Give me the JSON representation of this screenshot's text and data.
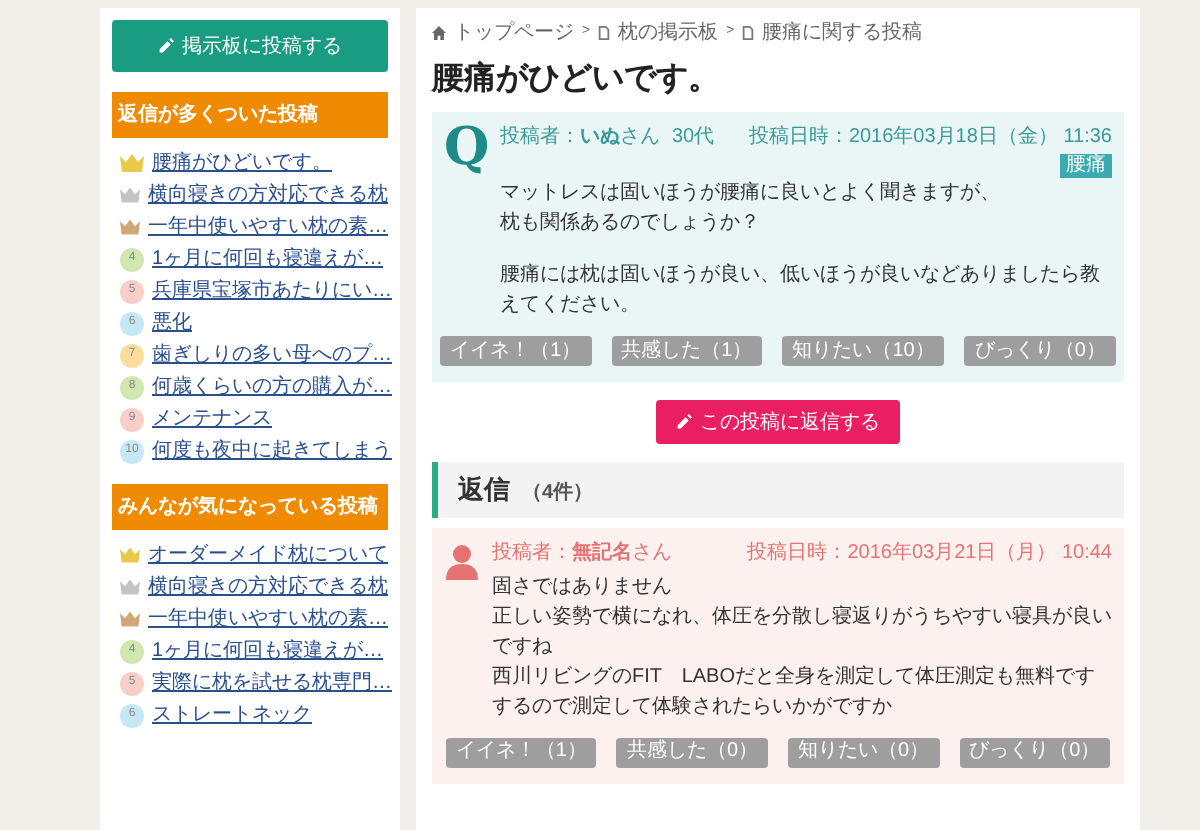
{
  "sidebar": {
    "post_button": {
      "label": "掲示板に投稿する"
    },
    "rankings": [
      {
        "title": "返信が多くついた投稿",
        "items": [
          {
            "kind": "crown",
            "color": "#e9c84a",
            "label": "腰痛がひどいです。"
          },
          {
            "kind": "crown",
            "color": "#c4c4c4",
            "label": "横向寝きの方対応できる枕"
          },
          {
            "kind": "crown",
            "color": "#d0a878",
            "label": "一年中使いやすい枕の素…"
          },
          {
            "kind": "number",
            "number": "4",
            "color": "#cfe8b0",
            "label": "1ヶ月に何回も寝違えが…"
          },
          {
            "kind": "number",
            "number": "5",
            "color": "#f8cfc8",
            "label": "兵庫県宝塚市あたりにい…"
          },
          {
            "kind": "number",
            "number": "6",
            "color": "#c6e8f6",
            "label": "悪化"
          },
          {
            "kind": "number",
            "number": "7",
            "color": "#fbdc9c",
            "label": "歯ぎしりの多い母へのプ…"
          },
          {
            "kind": "number",
            "number": "8",
            "color": "#cfe8b0",
            "label": "何歳くらいの方の購入が…"
          },
          {
            "kind": "number",
            "number": "9",
            "color": "#f8cfc8",
            "label": "メンテナンス"
          },
          {
            "kind": "number",
            "number": "10",
            "color": "#c6e8f6",
            "label": "何度も夜中に起きてしまう"
          }
        ]
      },
      {
        "title": "みんなが気になっている投稿",
        "items": [
          {
            "kind": "crown",
            "color": "#e9c84a",
            "label": "オーダーメイド枕について"
          },
          {
            "kind": "crown",
            "color": "#c4c4c4",
            "label": "横向寝きの方対応できる枕"
          },
          {
            "kind": "crown",
            "color": "#d0a878",
            "label": "一年中使いやすい枕の素…"
          },
          {
            "kind": "number",
            "number": "4",
            "color": "#cfe8b0",
            "label": "1ヶ月に何回も寝違えが…"
          },
          {
            "kind": "number",
            "number": "5",
            "color": "#f8cfc8",
            "label": "実際に枕を試せる枕専門…"
          },
          {
            "kind": "number",
            "number": "6",
            "color": "#c6e8f6",
            "label": "ストレートネック"
          }
        ]
      }
    ]
  },
  "breadcrumb": [
    {
      "kind": "home",
      "label": "トップページ"
    },
    {
      "kind": "separator",
      "label": ">"
    },
    {
      "kind": "page",
      "label": "枕の掲示板"
    },
    {
      "kind": "separator",
      "label": ">"
    },
    {
      "kind": "page",
      "label": "腰痛に関する投稿"
    }
  ],
  "title": "腰痛がひどいです。",
  "question": {
    "mark": "Q",
    "author": "投稿者：**いぬ**さん",
    "age": "30代",
    "date": "投稿日時：2016年03月18日（金） 11:36",
    "tag": "腰痛",
    "paragraphs": [
      [
        "マットレスは固いほうが腰痛に良いとよく聞きますが、",
        "枕も関係あるのでしょうか？"
      ],
      [
        "腰痛には枕は固いほうが良い、低いほうが良いなどありましたら教えてください。"
      ]
    ],
    "reactions": [
      "イイネ！（1）",
      "共感した（1）",
      "知りたい（10）",
      "びっくり（0）"
    ]
  },
  "reply_button": {
    "label": "この投稿に返信する"
  },
  "replies": {
    "title": "返信",
    "count": "（4件）",
    "items": [
      {
        "author": "投稿者：**無記名**さん",
        "date": "投稿日時：2016年03月21日（月） 10:44",
        "lines": [
          "固さではありません",
          "正しい姿勢で横になれ、体圧を分散し寝返りがうちやすい寝具が良いですね",
          "西川リビングのFIT　LABOだと全身を測定して体圧測定も無料ですするので測定して体験されたらいかがですか"
        ],
        "reactions": [
          "イイネ！（1）",
          "共感した（0）",
          "知りたい（0）",
          "びっくり（0）"
        ]
      }
    ]
  }
}
